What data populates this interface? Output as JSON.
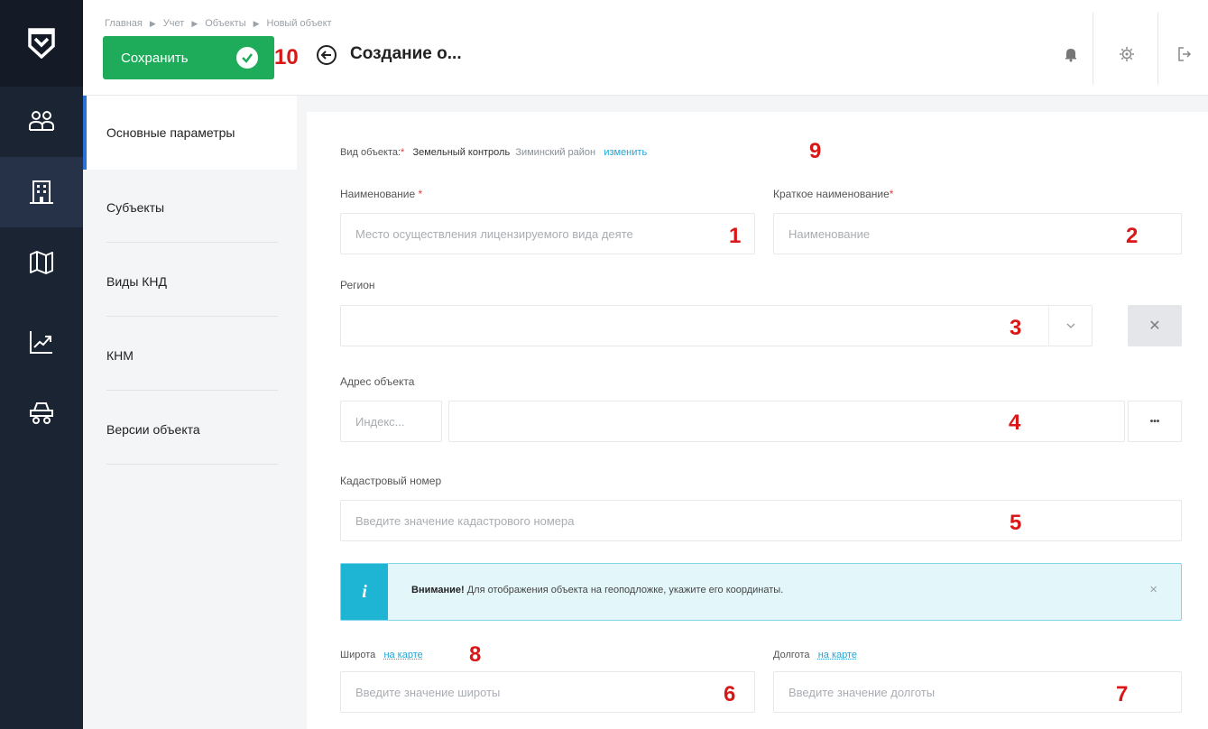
{
  "breadcrumb": [
    "Главная",
    "Учет",
    "Объекты",
    "Новый объект"
  ],
  "header": {
    "save_label": "Сохранить",
    "title": "Создание о...",
    "save_annotation": "10"
  },
  "subnav": {
    "items": [
      {
        "label": "Основные параметры"
      },
      {
        "label": "Субъекты"
      },
      {
        "label": "Виды КНД"
      },
      {
        "label": "КНМ"
      },
      {
        "label": "Версии объекта"
      }
    ]
  },
  "form": {
    "object_type": {
      "label": "Вид объекта:",
      "required_mark": "*",
      "value": "Земельный контроль",
      "district": "Зиминский район",
      "change_link": "изменить",
      "annotation": "9"
    },
    "name": {
      "label": "Наименование",
      "required_mark": "*",
      "value": "Место осуществления лицензируемого вида деяте",
      "annotation": "1"
    },
    "short_name": {
      "label": "Краткое наименование",
      "required_mark": "*",
      "placeholder": "Наименование",
      "annotation": "2"
    },
    "region": {
      "label": "Регион",
      "value": "",
      "annotation": "3"
    },
    "address": {
      "label": "Адрес объекта",
      "index_placeholder": "Индекс...",
      "more_label": "•••",
      "annotation": "4"
    },
    "cadastral": {
      "label": "Кадастровый номер",
      "placeholder": "Введите значение кадастрового номера",
      "annotation": "5"
    },
    "alert": {
      "icon": "i",
      "bold": "Внимание!",
      "text": " Для отображения объекта на геоподложке, укажите его координаты.",
      "close": "×"
    },
    "latitude": {
      "label": "Широта",
      "map_link": "на карте",
      "placeholder": "Введите значение широты",
      "annotation": "6",
      "link_annotation": "8"
    },
    "longitude": {
      "label": "Долгота",
      "map_link": "на карте",
      "placeholder": "Введите значение долготы",
      "annotation": "7"
    }
  },
  "colors": {
    "sidebar": "#1b2433",
    "save": "#1fac5a",
    "accent": "#2b72d8",
    "link": "#20a5d6",
    "annotation": "#d81818",
    "alert_icon": "#1eb4d4"
  },
  "icons": {
    "rail": [
      "shield-logo-icon",
      "users-icon",
      "building-icon",
      "map-icon",
      "chart-icon",
      "car-icon"
    ],
    "top": [
      "bell-icon",
      "settings-icon",
      "logout-icon"
    ]
  }
}
